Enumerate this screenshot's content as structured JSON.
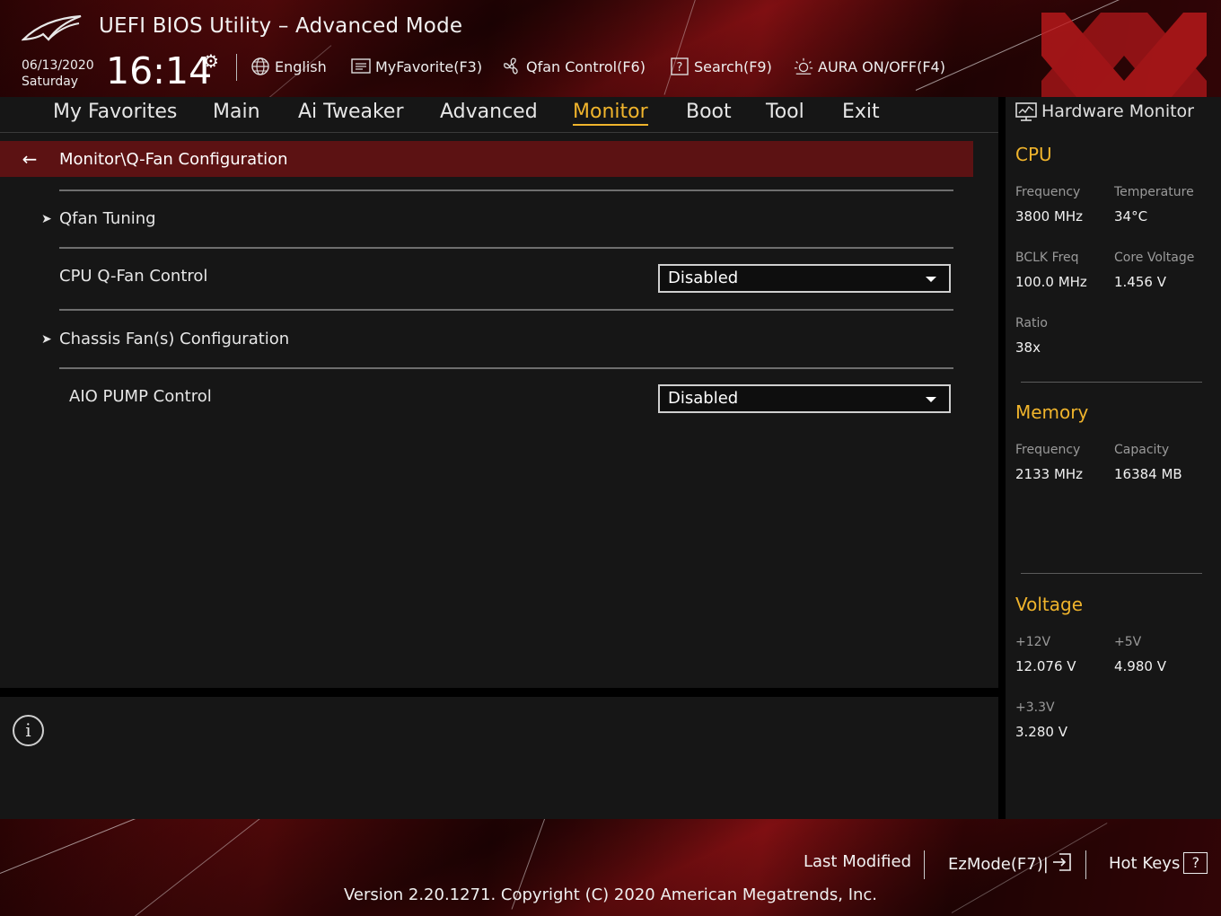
{
  "header": {
    "title": "UEFI BIOS Utility – Advanced Mode",
    "date": "06/13/2020",
    "weekday": "Saturday",
    "time": "16:14",
    "tools": {
      "language": "English",
      "favorite": "MyFavorite(F3)",
      "qfan": "Qfan Control(F6)",
      "search": "Search(F9)",
      "aura": "AURA ON/OFF(F4)"
    }
  },
  "nav": {
    "tabs": [
      "My Favorites",
      "Main",
      "Ai Tweaker",
      "Advanced",
      "Monitor",
      "Boot",
      "Tool",
      "Exit"
    ],
    "active": "Monitor"
  },
  "main": {
    "breadcrumb": "Monitor\\Q-Fan Configuration",
    "items": {
      "qfan_tuning": "Qfan Tuning",
      "cpu_qfan_label": "CPU Q-Fan Control",
      "cpu_qfan_value": "Disabled",
      "chassis": "Chassis Fan(s) Configuration",
      "aio_label": "AIO PUMP Control",
      "aio_value": "Disabled"
    }
  },
  "hw_monitor": {
    "title": "Hardware Monitor",
    "cpu": {
      "heading": "CPU",
      "frequency_label": "Frequency",
      "frequency": "3800 MHz",
      "temperature_label": "Temperature",
      "temperature": "34°C",
      "bclk_label": "BCLK Freq",
      "bclk": "100.0 MHz",
      "core_voltage_label": "Core Voltage",
      "core_voltage": "1.456 V",
      "ratio_label": "Ratio",
      "ratio": "38x"
    },
    "memory": {
      "heading": "Memory",
      "frequency_label": "Frequency",
      "frequency": "2133 MHz",
      "capacity_label": "Capacity",
      "capacity": "16384 MB"
    },
    "voltage": {
      "heading": "Voltage",
      "v12_label": "+12V",
      "v12": "12.076 V",
      "v5_label": "+5V",
      "v5": "4.980 V",
      "v33_label": "+3.3V",
      "v33": "3.280 V"
    }
  },
  "footer": {
    "last_modified": "Last Modified",
    "ezmode": "EzMode(F7)|",
    "hotkeys": "Hot Keys",
    "hotkeys_key": "?",
    "copyright": "Version 2.20.1271. Copyright (C) 2020 American Megatrends, Inc."
  },
  "colors": {
    "accent": "#f0b42c",
    "breadcrumb_bg": "#5c1213",
    "panel_bg": "#161616"
  },
  "icons": [
    "rog-logo-icon",
    "gear-icon",
    "globe-icon",
    "favorite-list-icon",
    "fan-icon",
    "search-help-icon",
    "aura-icon",
    "back-arrow-icon",
    "chevron-right-icon",
    "dropdown-caret-icon",
    "info-icon",
    "monitor-icon",
    "exit-icon",
    "help-key-icon"
  ]
}
